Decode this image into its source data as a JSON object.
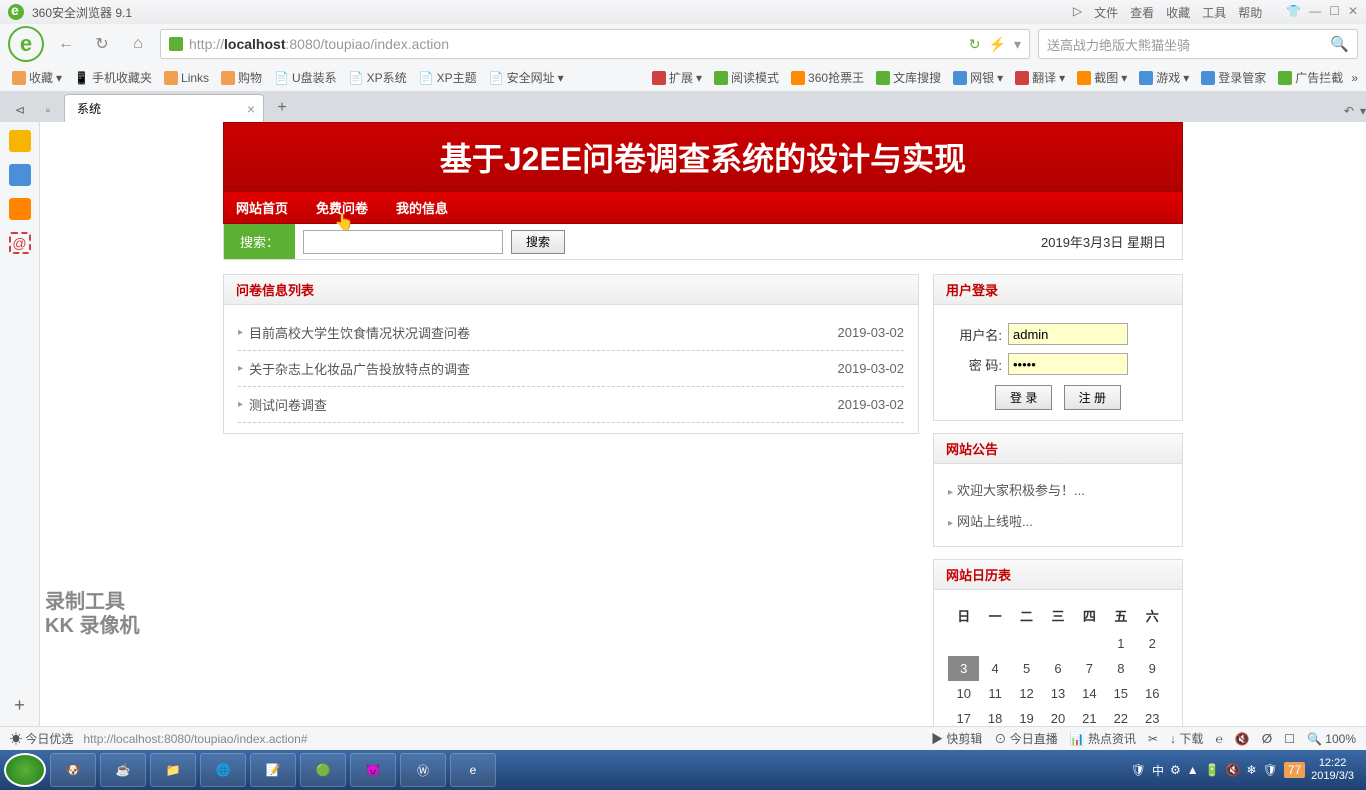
{
  "browser": {
    "name": "360安全浏览器 9.1",
    "url_proto": "http://",
    "url_host": "localhost",
    "url_port": ":8080",
    "url_path": "/toupiao/index.action",
    "search_placeholder": "送高战力绝版大熊猫坐骑",
    "menus": [
      "文件",
      "查看",
      "收藏",
      "工具",
      "帮助"
    ]
  },
  "bookmarks": {
    "fav": "收藏",
    "items": [
      "手机收藏夹",
      "Links",
      "购物",
      "U盘装系",
      "XP系统",
      "XP主题",
      "安全网址"
    ],
    "right": [
      "扩展",
      "阅读模式",
      "360抢票王",
      "文库搜搜",
      "网银",
      "翻译",
      "截图",
      "游戏",
      "登录管家",
      "广告拦截"
    ]
  },
  "tab": {
    "title": "系统"
  },
  "page": {
    "banner": "基于J2EE问卷调查系统的设计与实现",
    "nav": [
      "网站首页",
      "免费问卷",
      "我的信息"
    ],
    "search_label": "搜索：",
    "search_btn": "搜索",
    "date": "2019年3月3日 星期日",
    "list_title": "问卷信息列表",
    "items": [
      {
        "t": "目前高校大学生饮食情况状况调查问卷",
        "d": "2019-03-02"
      },
      {
        "t": "关于杂志上化妆品广告投放特点的调查",
        "d": "2019-03-02"
      },
      {
        "t": "测试问卷调查",
        "d": "2019-03-02"
      }
    ],
    "login_title": "用户登录",
    "login_user_lbl": "用户名:",
    "login_pwd_lbl": "密  码:",
    "login_user": "admin",
    "login_pwd": "•••••",
    "login_btn": "登 录",
    "reg_btn": "注 册",
    "notice_title": "网站公告",
    "notices": [
      "欢迎大家积极参与！...",
      "网站上线啦..."
    ],
    "cal_title": "网站日历表",
    "cal_head": [
      "日",
      "一",
      "二",
      "三",
      "四",
      "五",
      "六"
    ],
    "cal_rows": [
      [
        "",
        "",
        "",
        "",
        "",
        "1",
        "2"
      ],
      [
        "3",
        "4",
        "5",
        "6",
        "7",
        "8",
        "9"
      ],
      [
        "10",
        "11",
        "12",
        "13",
        "14",
        "15",
        "16"
      ],
      [
        "17",
        "18",
        "19",
        "20",
        "21",
        "22",
        "23"
      ]
    ],
    "cal_today": "3"
  },
  "status": {
    "today": "今日优选",
    "url": "http://localhost:8080/toupiao/index.action#",
    "items": [
      "快剪辑",
      "今日直播",
      "热点资讯",
      "下载"
    ],
    "zoom": "100%"
  },
  "tray": {
    "time": "12:22",
    "date": "2019/3/3",
    "badge": "77"
  },
  "recorder": {
    "l1": "录制工具",
    "l2": "KK 录像机"
  }
}
